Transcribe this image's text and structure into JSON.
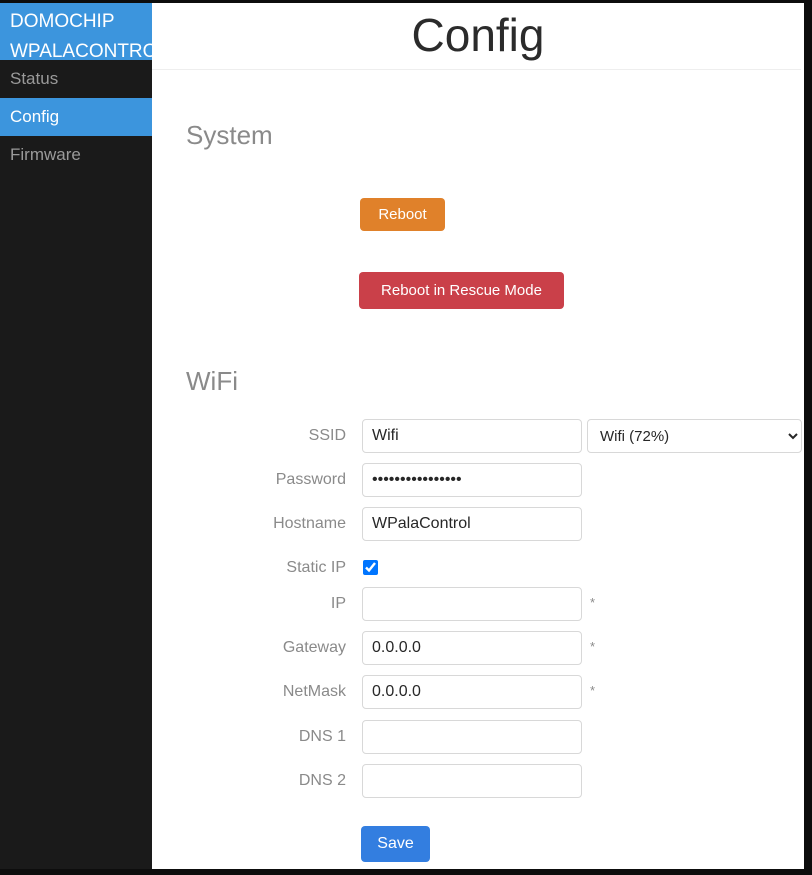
{
  "sidebar": {
    "brand_line1": "DOMOCHIP",
    "brand_line2": "WPALACONTROL",
    "items": [
      {
        "label": "Status",
        "active": false
      },
      {
        "label": "Config",
        "active": true
      },
      {
        "label": "Firmware",
        "active": false
      }
    ]
  },
  "header": {
    "title": "Config"
  },
  "system": {
    "section_title": "System",
    "reboot_label": "Reboot",
    "rescue_label": "Reboot in Rescue Mode"
  },
  "wifi": {
    "section_title": "WiFi",
    "fields": {
      "ssid_label": "SSID",
      "ssid_value": "Wifi",
      "ssid_scan_selected": "Wifi (72%)",
      "password_label": "Password",
      "password_value": "••••••••••••••••",
      "hostname_label": "Hostname",
      "hostname_value": "WPalaControl",
      "static_ip_label": "Static IP",
      "static_ip_checked": true,
      "ip_label": "IP",
      "ip_value": "",
      "gateway_label": "Gateway",
      "gateway_value": "0.0.0.0",
      "netmask_label": "NetMask",
      "netmask_value": "0.0.0.0",
      "dns1_label": "DNS 1",
      "dns1_value": "",
      "dns2_label": "DNS 2",
      "dns2_value": "",
      "required_marker": "*"
    },
    "save_label": "Save"
  },
  "colors": {
    "brand_blue": "#3c95dd",
    "sidebar_dark": "#1a1a1a",
    "reboot_orange": "#e0812a",
    "rescue_red": "#ca4049",
    "save_blue": "#337ee0",
    "label_gray": "#8a8a8a"
  }
}
